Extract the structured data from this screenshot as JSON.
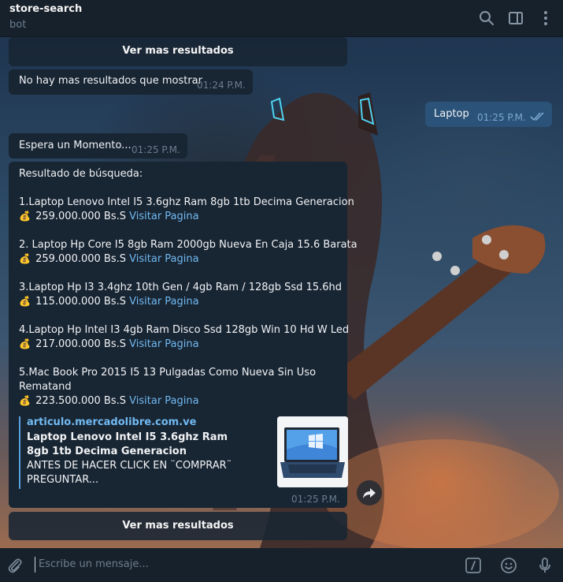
{
  "header": {
    "title": "store-search",
    "subtitle": "bot"
  },
  "buttons": {
    "more_results": "Ver mas resultados"
  },
  "messages": {
    "no_more": {
      "text": "No hay mas resultados que mostrar",
      "time": "01:24 P.M."
    },
    "laptop": {
      "text": "Laptop",
      "time": "01:25 P.M."
    },
    "wait": {
      "text": "Espera un Momento...",
      "time": "01:25 P.M."
    },
    "results": {
      "heading": "Resultado de búsqueda:",
      "items": [
        {
          "title": "1.Laptop Lenovo Intel I5 3.6ghz Ram 8gb 1tb Decima Generacion",
          "price": "259.000.000 Bs.S",
          "link": "Visitar Pagina"
        },
        {
          "title": "2. Laptop Hp Core I5 8gb Ram 2000gb Nueva En Caja 15.6 Barata",
          "price": "259.000.000 Bs.S",
          "link": "Visitar Pagina"
        },
        {
          "title": "3.Laptop Hp I3 3.4ghz 10th Gen / 4gb Ram / 128gb Ssd  15.6hd",
          "price": "115.000.000 Bs.S",
          "link": "Visitar Pagina"
        },
        {
          "title": "4.Laptop Hp Intel I3 4gb Ram Disco Ssd 128gb Win 10 Hd W Led",
          "price": "217.000.000 Bs.S",
          "link": "Visitar Pagina"
        },
        {
          "title_line1": "5.Mac Book Pro 2015 I5 13 Pulgadas Como Nueva Sin Uso",
          "title_line2": "Rematand",
          "price": "223.500.000 Bs.S",
          "link": "Visitar Pagina"
        }
      ],
      "preview": {
        "site": "articulo.mercadolibre.com.ve",
        "title": "Laptop Lenovo Intel I5 3.6ghz Ram 8gb 1tb Decima Generacion",
        "description": "ANTES DE HACER CLICK EN ¨COMPRAR¨ PREGUNTAR..."
      },
      "time": "01:25 P.M."
    }
  },
  "composer": {
    "placeholder": "Escribe un mensaje..."
  },
  "icons": {
    "money": "money-bag-icon",
    "search": "search-icon",
    "sidebar": "sidebar-toggle-icon",
    "more": "more-vertical-icon",
    "attach": "paperclip-icon",
    "commands": "slash-commands-icon",
    "emoji": "emoji-icon",
    "mic": "microphone-icon",
    "read": "double-check-icon",
    "share": "share-icon"
  },
  "colors": {
    "header_bg": "#17212b",
    "bubble_in": "#182533",
    "bubble_out": "#2b5278",
    "link": "#71baf2",
    "muted": "#6d7f8f"
  }
}
